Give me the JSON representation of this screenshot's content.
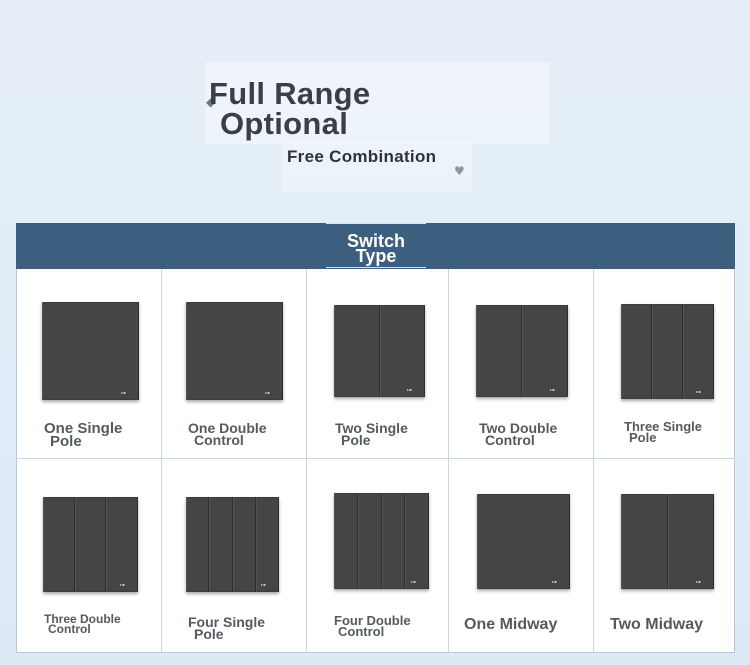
{
  "hero": {
    "title_line1": "Full Range",
    "title_line2": "Optional",
    "subtitle": "Free Combination"
  },
  "section": {
    "header_line1": "Switch",
    "header_line2": "Type"
  },
  "colors": {
    "header_bg": "#3d5f7f",
    "switch_panel": "#434547",
    "label_text": "#555a60"
  },
  "switch_types": [
    {
      "line1": "One Single",
      "line2": "Pole",
      "gangs": 1
    },
    {
      "line1": "One Double",
      "line2": "Control",
      "gangs": 1
    },
    {
      "line1": "Two Single",
      "line2": "Pole",
      "gangs": 2
    },
    {
      "line1": "Two Double",
      "line2": "Control",
      "gangs": 2
    },
    {
      "line1": "Three Single",
      "line2": "Pole",
      "gangs": 3
    },
    {
      "line1": "Three Double",
      "line2": "Control",
      "gangs": 3
    },
    {
      "line1": "Four Single",
      "line2": "Pole",
      "gangs": 4
    },
    {
      "line1": "Four Double",
      "line2": "Control",
      "gangs": 4
    },
    {
      "line1": "One Midway",
      "line2": "",
      "gangs": 1
    },
    {
      "line1": "Two Midway",
      "line2": "",
      "gangs": 2
    }
  ]
}
